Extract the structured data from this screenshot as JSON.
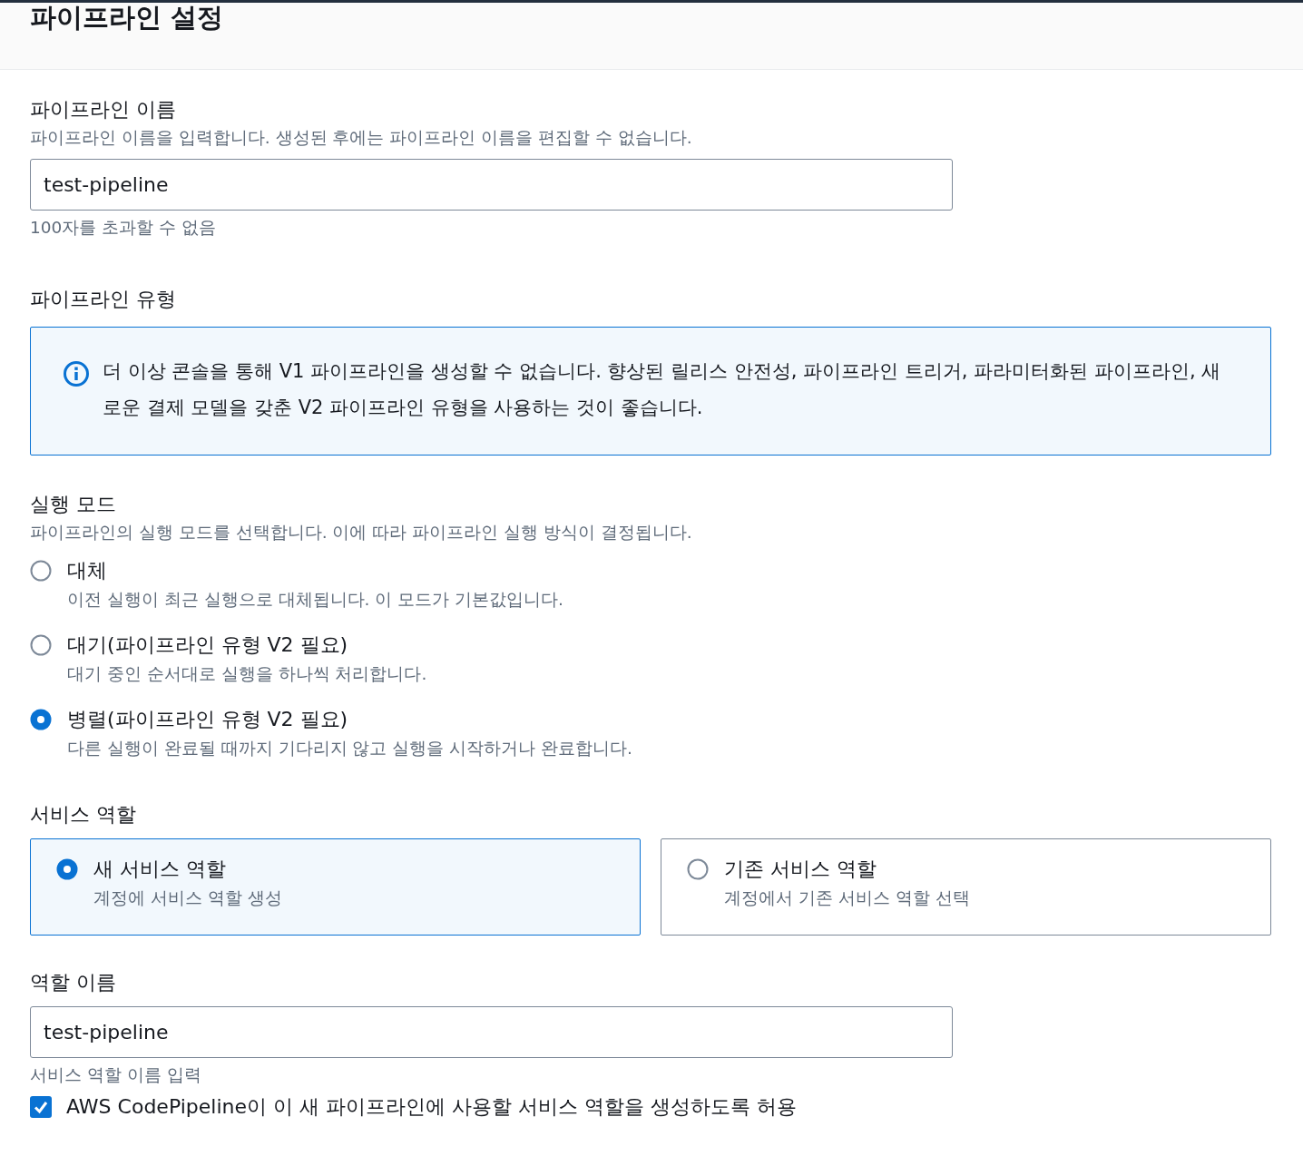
{
  "header": {
    "title": "파이프라인 설정"
  },
  "pipeline_name": {
    "label": "파이프라인 이름",
    "description": "파이프라인 이름을 입력합니다. 생성된 후에는 파이프라인 이름을 편집할 수 없습니다.",
    "value": "test-pipeline",
    "constraint": "100자를 초과할 수 없음"
  },
  "pipeline_type": {
    "label": "파이프라인 유형",
    "info": {
      "message": "더 이상 콘솔을 통해 V1 파이프라인을 생성할 수 없습니다. 향상된 릴리스 안전성, 파이프라인 트리거, 파라미터화된 파이프라인, 새로운 결제 모델을 갖춘 V2 파이프라인 유형을 사용하는 것이 좋습니다."
    }
  },
  "execution_mode": {
    "label": "실행 모드",
    "description": "파이프라인의 실행 모드를 선택합니다. 이에 따라 파이프라인 실행 방식이 결정됩니다.",
    "options": [
      {
        "label": "대체",
        "description": "이전 실행이 최근 실행으로 대체됩니다. 이 모드가 기본값입니다.",
        "selected": false
      },
      {
        "label": "대기(파이프라인 유형 V2 필요)",
        "description": "대기 중인 순서대로 실행을 하나씩 처리합니다.",
        "selected": false
      },
      {
        "label": "병렬(파이프라인 유형 V2 필요)",
        "description": "다른 실행이 완료될 때까지 기다리지 않고 실행을 시작하거나 완료합니다.",
        "selected": true
      }
    ]
  },
  "service_role": {
    "label": "서비스 역할",
    "options": [
      {
        "label": "새 서비스 역할",
        "description": "계정에 서비스 역할 생성",
        "selected": true
      },
      {
        "label": "기존 서비스 역할",
        "description": "계정에서 기존 서비스 역할 선택",
        "selected": false
      }
    ]
  },
  "role_name": {
    "label": "역할 이름",
    "value": "test-pipeline",
    "hint": "서비스 역할 이름 입력"
  },
  "allow_create_role": {
    "label": "AWS CodePipeline이 이 새 파이프라인에 사용할 서비스 역할을 생성하도록 허용",
    "checked": true
  }
}
